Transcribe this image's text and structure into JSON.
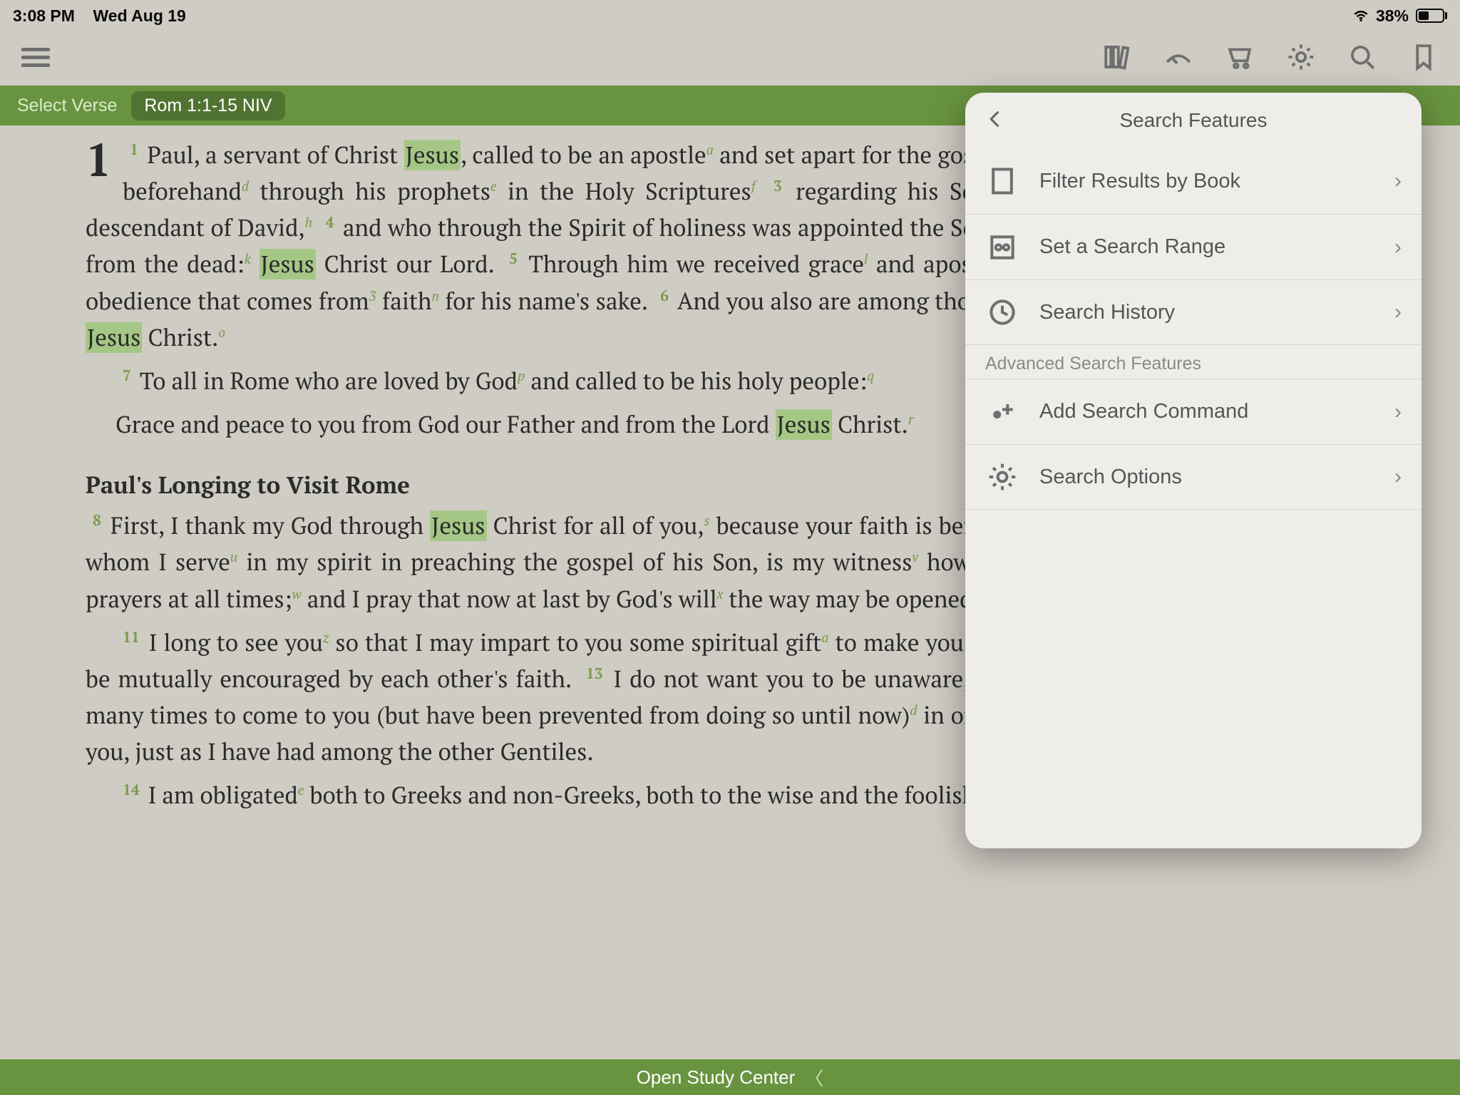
{
  "status": {
    "time": "3:08 PM",
    "date": "Wed Aug 19",
    "battery_pct": "38%"
  },
  "verse_bar": {
    "select_label": "Select Verse",
    "reference": "Rom 1:1-15 NIV"
  },
  "passage": {
    "chapter": "1",
    "section_heading": "Paul's Longing to Visit Rome"
  },
  "popover": {
    "title": "Search Features",
    "items": [
      {
        "label": "Filter Results by Book"
      },
      {
        "label": "Set a Search Range"
      },
      {
        "label": "Search History"
      }
    ],
    "subhead": "Advanced Search Features",
    "adv_items": [
      {
        "label": "Add Search Command"
      },
      {
        "label": "Search Options"
      }
    ]
  },
  "bottom": {
    "label": "Open Study Center"
  }
}
